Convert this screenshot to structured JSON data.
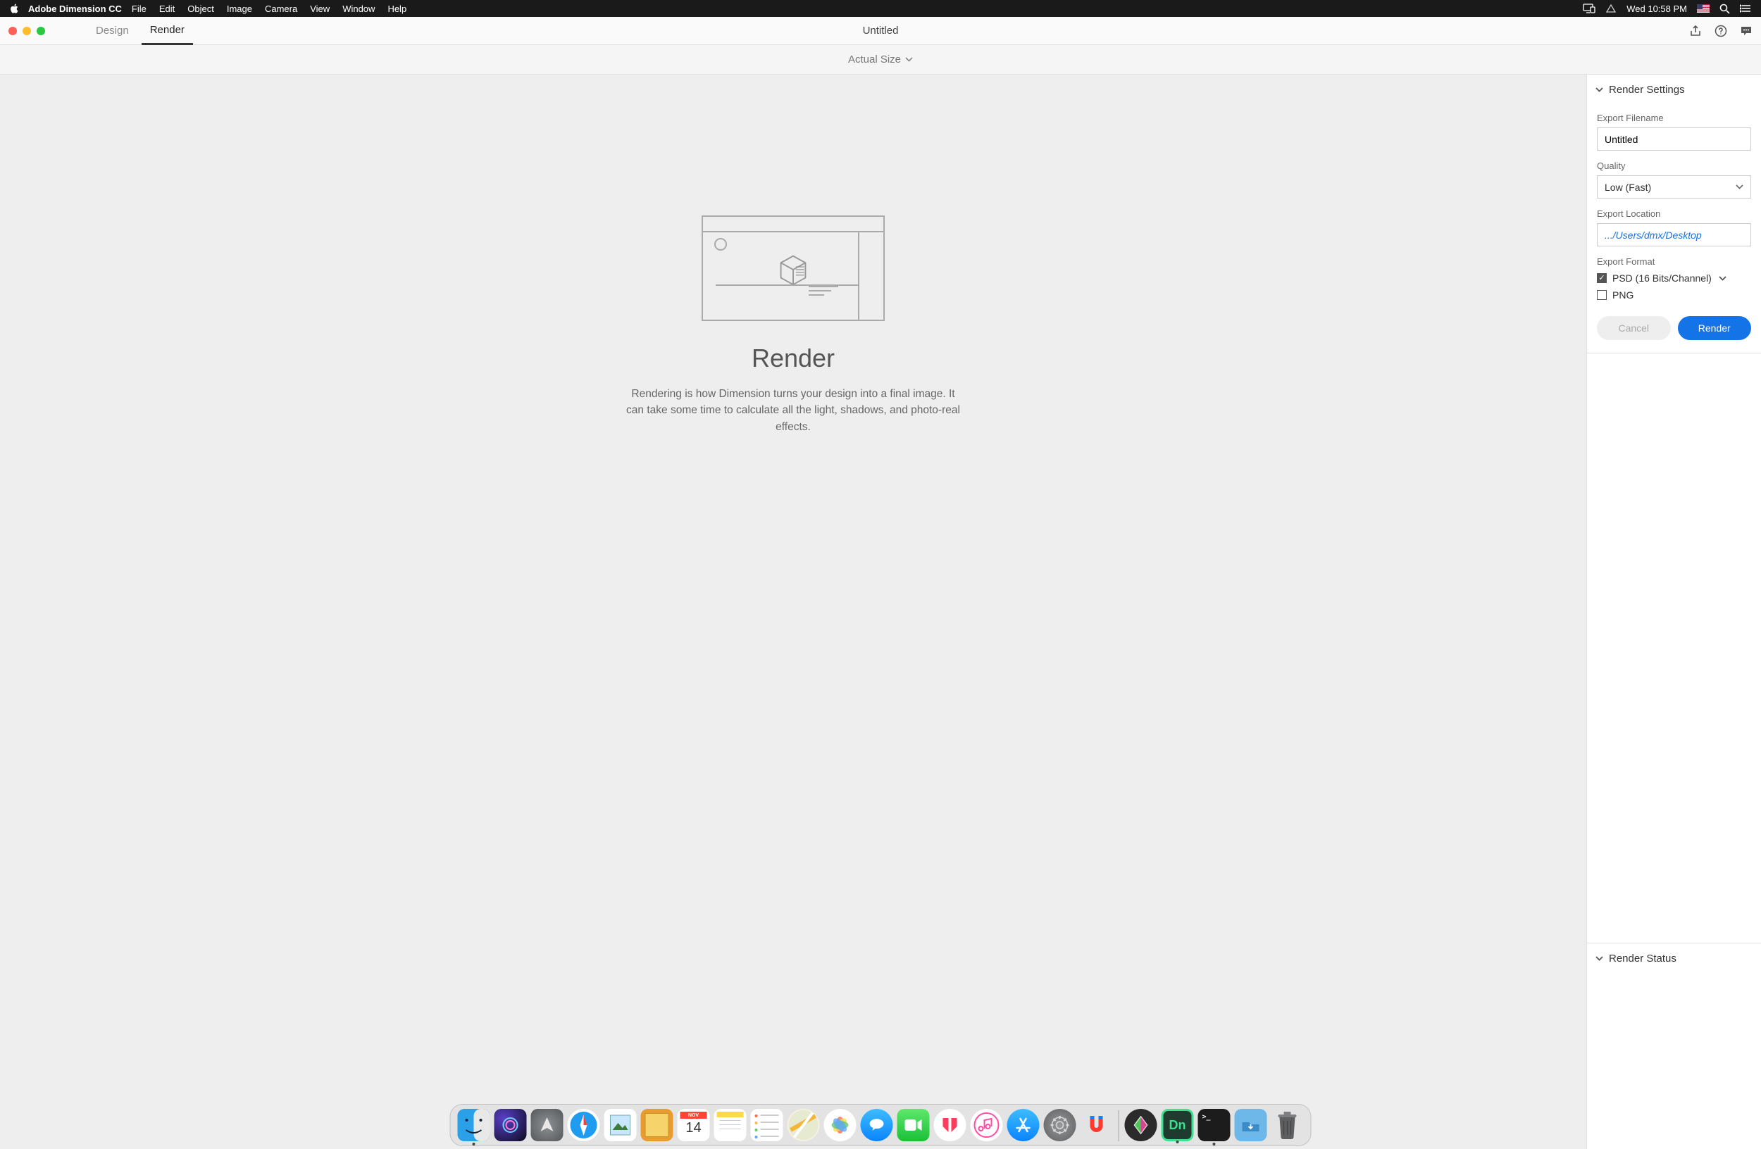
{
  "menubar": {
    "app_name": "Adobe Dimension CC",
    "items": [
      "File",
      "Edit",
      "Object",
      "Image",
      "Camera",
      "View",
      "Window",
      "Help"
    ],
    "clock": "Wed 10:58 PM"
  },
  "titlebar": {
    "tabs": [
      "Design",
      "Render"
    ],
    "active_tab": 1,
    "document_title": "Untitled"
  },
  "toolbar": {
    "zoom_label": "Actual Size"
  },
  "stage": {
    "title": "Render",
    "description": "Rendering is how Dimension turns your design into a final image. It can take some time to calculate all the light, shadows, and photo-real effects."
  },
  "panel": {
    "settings_header": "Render Settings",
    "export_filename_label": "Export Filename",
    "export_filename_value": "Untitled",
    "quality_label": "Quality",
    "quality_value": "Low (Fast)",
    "location_label": "Export Location",
    "location_value": ".../Users/dmx/Desktop",
    "format_label": "Export Format",
    "formats": [
      {
        "label": "PSD (16 Bits/Channel)",
        "checked": true,
        "has_chevron": true
      },
      {
        "label": "PNG",
        "checked": false,
        "has_chevron": false
      }
    ],
    "cancel_label": "Cancel",
    "render_label": "Render",
    "status_header": "Render Status"
  },
  "dock": {
    "date_month": "NOV",
    "date_day": "14",
    "dn_label": "Dn"
  }
}
